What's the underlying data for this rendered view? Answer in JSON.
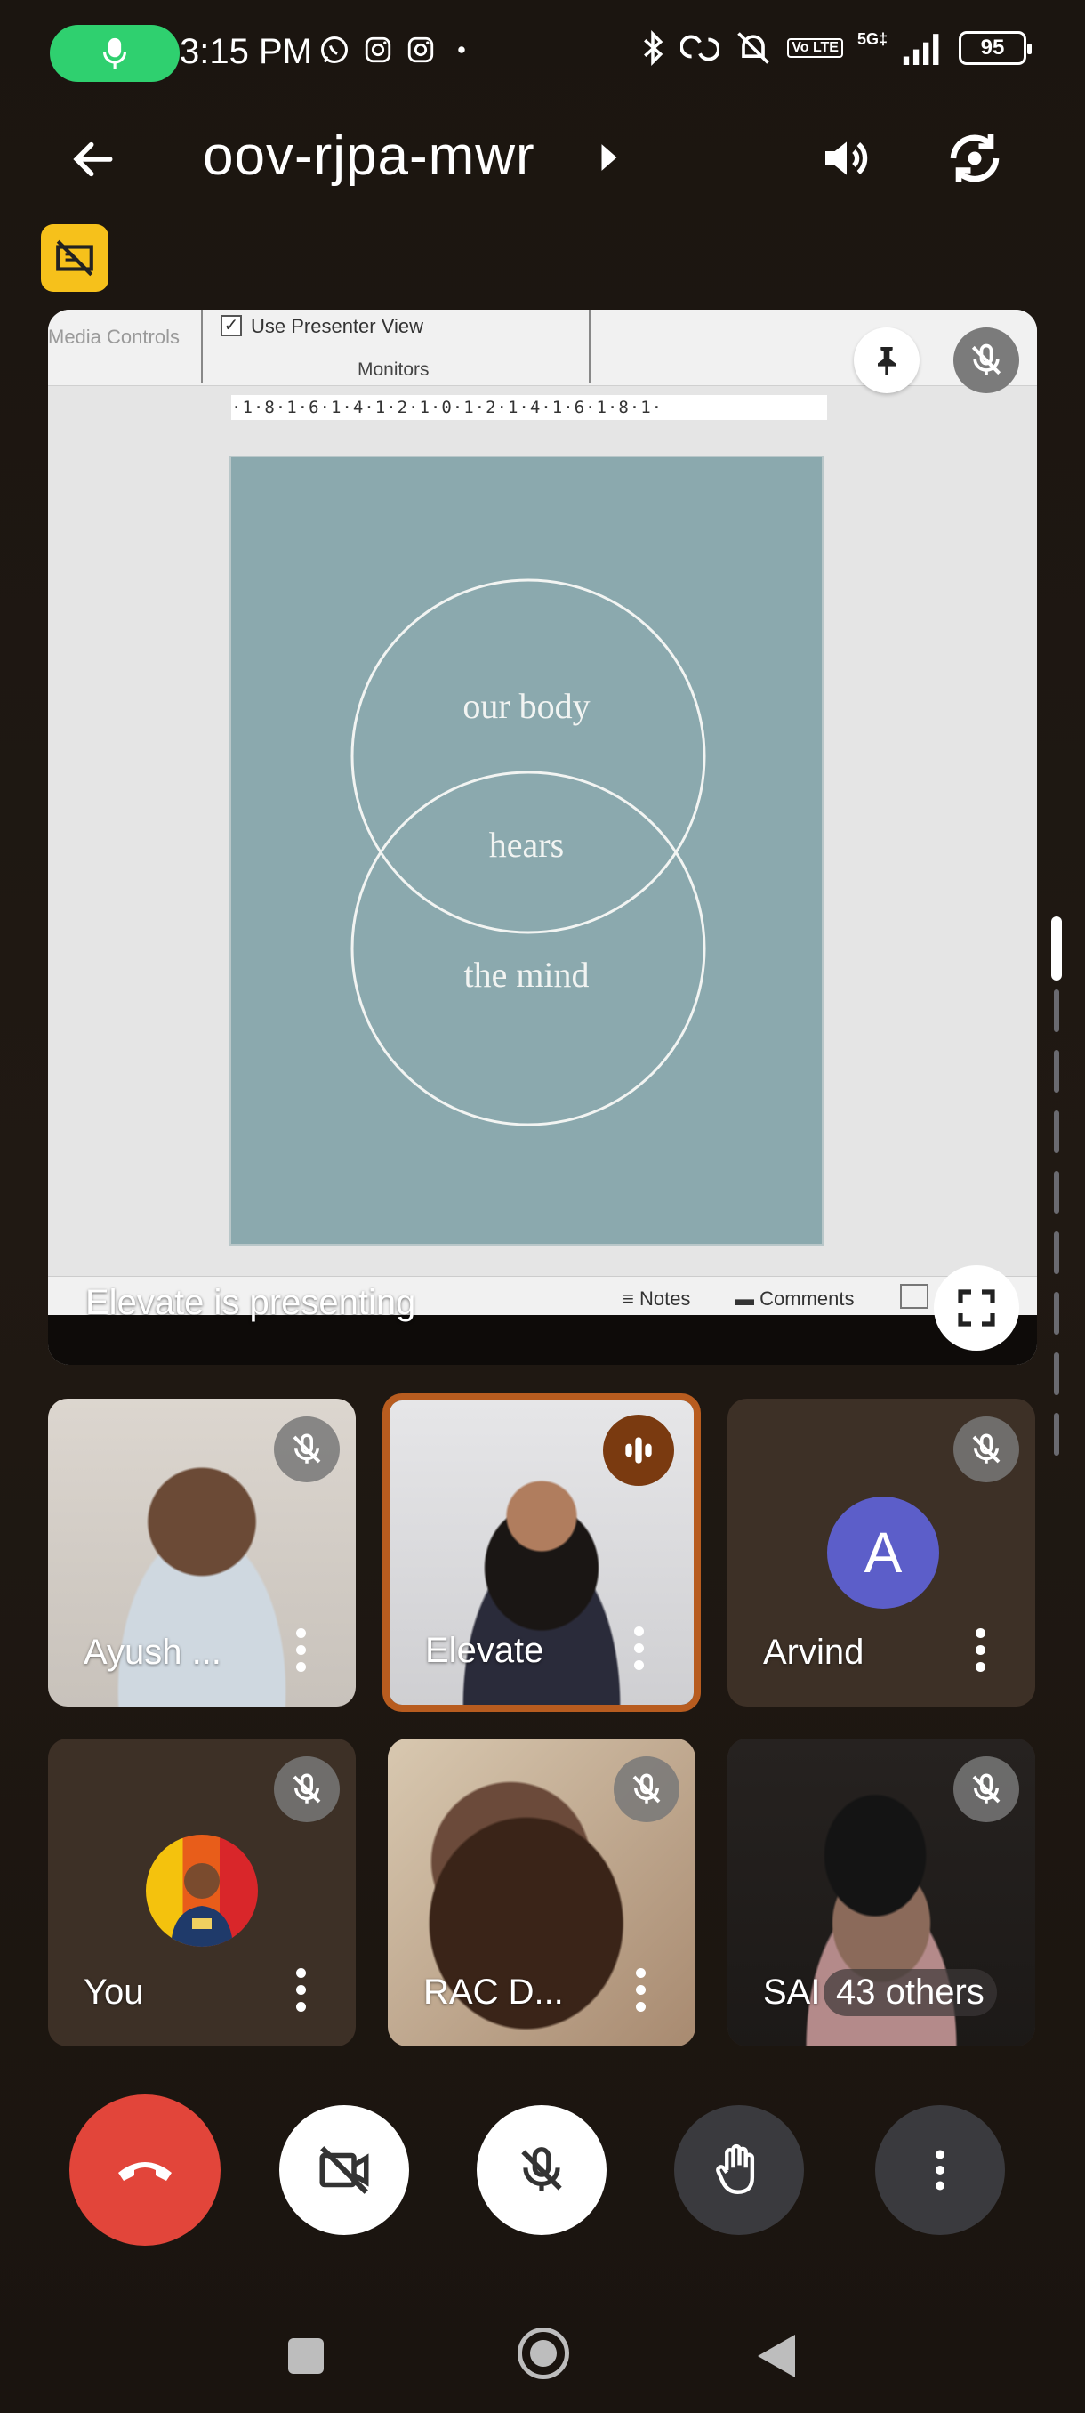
{
  "status_bar": {
    "time": "3:15 PM",
    "battery": "95",
    "network_label": "5G‡",
    "volte_label": "Vo LTE"
  },
  "app_bar": {
    "meeting_code": "oov-rjpa-mwr"
  },
  "presentation": {
    "ribbon": {
      "media_controls": "Media Controls",
      "presenter_view": "Use Presenter View",
      "monitors": "Monitors"
    },
    "ruler": "·1·8·1·6·1·4·1·2·1·0·1·2·1·4·1·6·1·8·1·",
    "slide": {
      "line1": "our body",
      "line2": "hears",
      "line3": "the mind"
    },
    "notes_label": "Notes",
    "comments_label": "Comments",
    "caption": "Elevate is presenting"
  },
  "participants": [
    {
      "name": "Ayush ...",
      "muted": true
    },
    {
      "name": "Elevate",
      "speaking": true
    },
    {
      "name": "Arvind",
      "avatar_letter": "A",
      "muted": true
    },
    {
      "name": "You",
      "muted": true
    },
    {
      "name": "RAC D...",
      "muted": true
    },
    {
      "name": "SAI",
      "others": "43 others",
      "muted": true
    }
  ],
  "colors": {
    "end_call": "#e2453a",
    "mic_pill": "#2fd06f",
    "no_camera_badge": "#f6c11b",
    "speaking_border": "#b85c1f",
    "slide_bg": "#8ba9ae",
    "avatar_arvind": "#5c5ec9"
  }
}
